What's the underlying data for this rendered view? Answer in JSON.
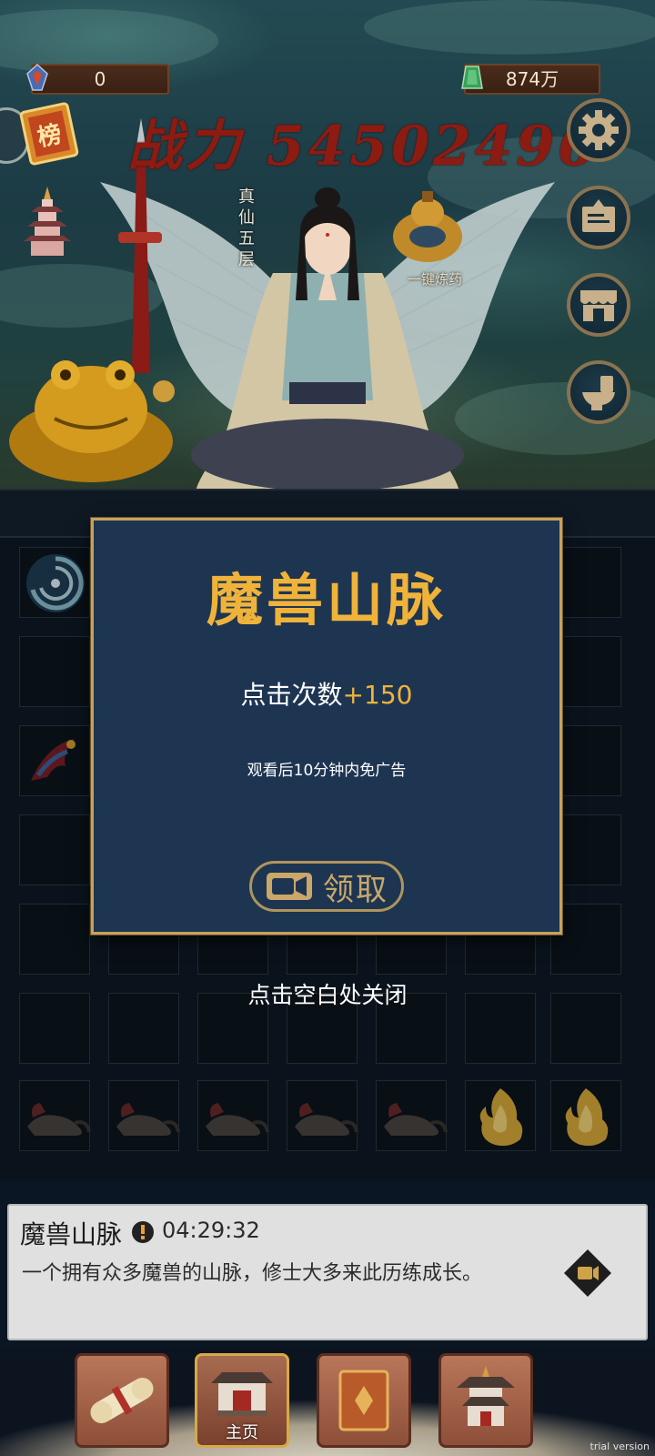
{
  "colors": {
    "popup_bg": "#1e3552",
    "popup_border": "#c7a25a",
    "title_gold": "#f0b33a",
    "power_red": "#8c1b12"
  },
  "resources": {
    "left": {
      "icon": "fire-gem-icon",
      "value": "0"
    },
    "right": {
      "icon": "jade-icon",
      "value": "874万"
    }
  },
  "combat_power": "战力 54502496",
  "rank_badge": "榜",
  "realm": "真仙五层",
  "alchemy_label": "一键炼药",
  "right_buttons": [
    {
      "name": "settings-button",
      "icon": "gear-icon"
    },
    {
      "name": "notice-button",
      "icon": "sign-board-icon"
    },
    {
      "name": "shop-button",
      "icon": "shop-stall-icon"
    },
    {
      "name": "toilet-button",
      "icon": "toilet-icon"
    }
  ],
  "popup": {
    "title": "魔兽山脉",
    "reward_prefix": "点击次数",
    "reward_amount": "+150",
    "note": "观看后10分钟内免广告",
    "claim_label": "领取"
  },
  "close_hint": "点击空白处关闭",
  "info": {
    "name": "魔兽山脉",
    "timer": "04:29:32",
    "description": "一个拥有众多魔兽的山脉，修士大多来此历练成长。"
  },
  "nav": [
    {
      "name": "nav-scroll",
      "icon": "scroll-icon",
      "label": ""
    },
    {
      "name": "nav-home",
      "icon": "temple-gate-icon",
      "label": "主页",
      "active": true
    },
    {
      "name": "nav-book",
      "icon": "book-icon",
      "label": ""
    },
    {
      "name": "nav-pavilion",
      "icon": "pavilion-icon",
      "label": ""
    }
  ],
  "watermark": "trial version"
}
